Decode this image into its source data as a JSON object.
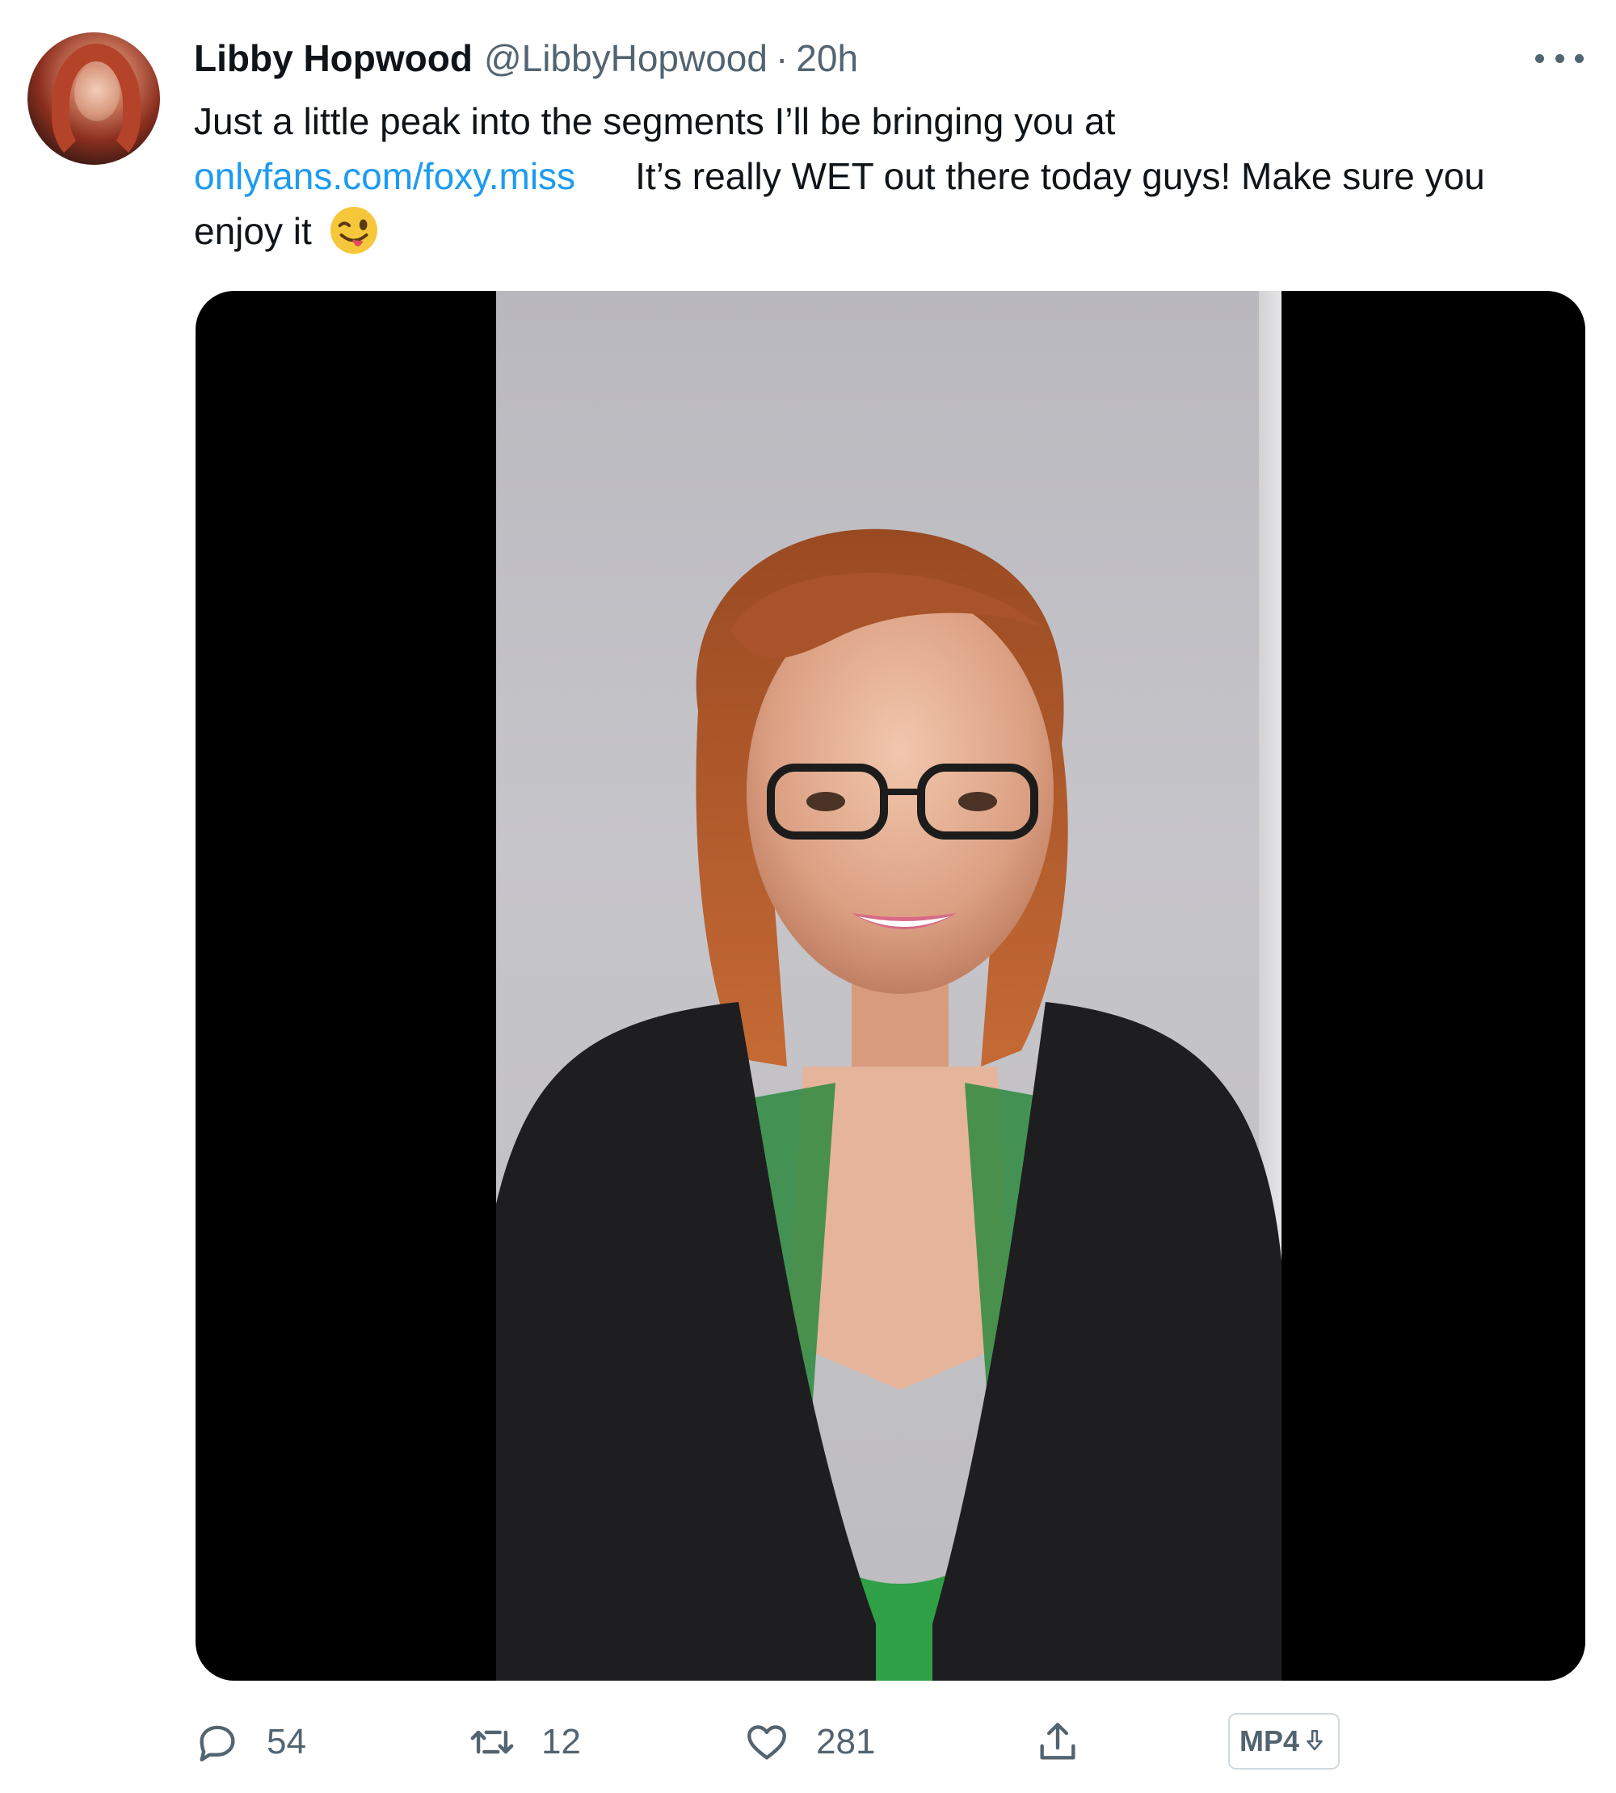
{
  "tweet": {
    "display_name": "Libby Hopwood",
    "handle": "@LibbyHopwood",
    "separator": "·",
    "time": "20h",
    "text_part1": "Just a little peak into the segments I’ll be bringing you at",
    "link_text": "onlyfans.com/foxy.miss",
    "text_part2": "It’s really WET out there today guys! Make sure you enjoy it",
    "emoji": "winking-face-with-tongue-emoji"
  },
  "actions": {
    "reply_count": "54",
    "retweet_count": "12",
    "like_count": "281",
    "mp4_label": "MP4"
  },
  "icons": {
    "more": "more-icon",
    "reply": "reply-icon",
    "retweet": "retweet-icon",
    "like": "heart-icon",
    "share": "share-icon",
    "download": "download-icon"
  },
  "colors": {
    "link": "#1d9bf0",
    "secondary_text": "#536471",
    "primary_text": "#0f1419",
    "media_background": "#000000"
  }
}
